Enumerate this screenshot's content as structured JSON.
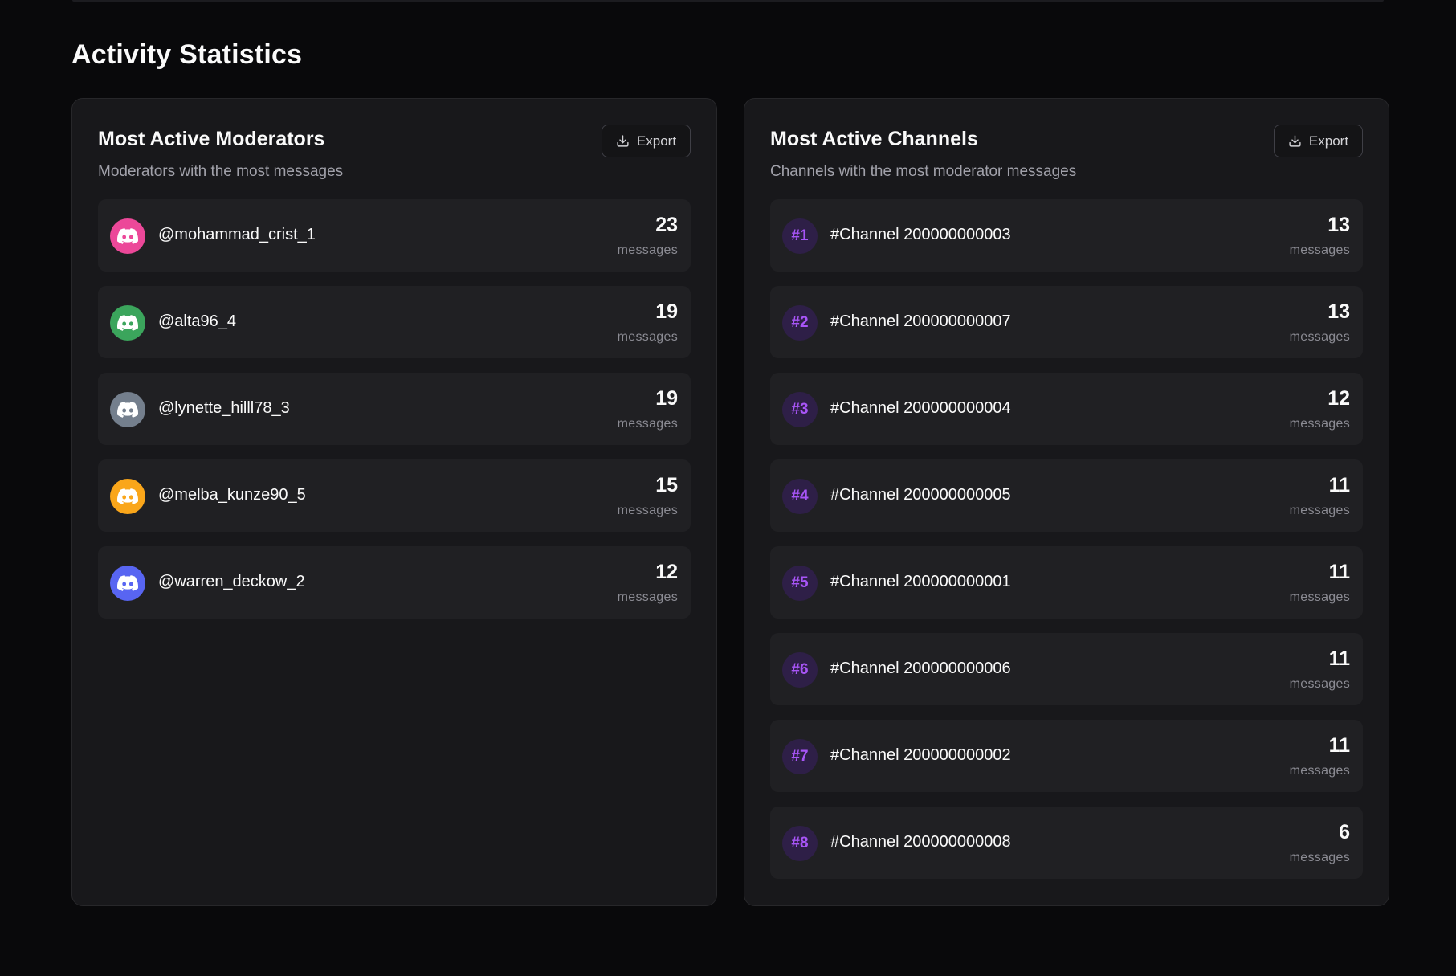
{
  "page": {
    "title": "Activity Statistics"
  },
  "moderators": {
    "title": "Most Active Moderators",
    "subtitle": "Moderators with the most messages",
    "export_label": "Export",
    "unit_label": "messages",
    "items": [
      {
        "name": "@mohammad_crist_1",
        "count": "23",
        "avatar_color": "#ec4899"
      },
      {
        "name": "@alta96_4",
        "count": "19",
        "avatar_color": "#3ba55c"
      },
      {
        "name": "@lynette_hilll78_3",
        "count": "19",
        "avatar_color": "#747f8d"
      },
      {
        "name": "@melba_kunze90_5",
        "count": "15",
        "avatar_color": "#faa61a"
      },
      {
        "name": "@warren_deckow_2",
        "count": "12",
        "avatar_color": "#5865f2"
      }
    ]
  },
  "channels": {
    "title": "Most Active Channels",
    "subtitle": "Channels with the most moderator messages",
    "export_label": "Export",
    "unit_label": "messages",
    "items": [
      {
        "rank": "#1",
        "name": "#Channel 200000000003",
        "count": "13"
      },
      {
        "rank": "#2",
        "name": "#Channel 200000000007",
        "count": "13"
      },
      {
        "rank": "#3",
        "name": "#Channel 200000000004",
        "count": "12"
      },
      {
        "rank": "#4",
        "name": "#Channel 200000000005",
        "count": "11"
      },
      {
        "rank": "#5",
        "name": "#Channel 200000000001",
        "count": "11"
      },
      {
        "rank": "#6",
        "name": "#Channel 200000000006",
        "count": "11"
      },
      {
        "rank": "#7",
        "name": "#Channel 200000000002",
        "count": "11"
      },
      {
        "rank": "#8",
        "name": "#Channel 200000000008",
        "count": "6"
      }
    ]
  },
  "icons": {
    "export": "download-icon",
    "avatar": "discord-icon"
  },
  "colors": {
    "background": "#09090b",
    "card": "#18181b",
    "row": "#202023",
    "channel_badge_bg": "#2e1f47",
    "channel_badge_text": "#a855f7"
  }
}
